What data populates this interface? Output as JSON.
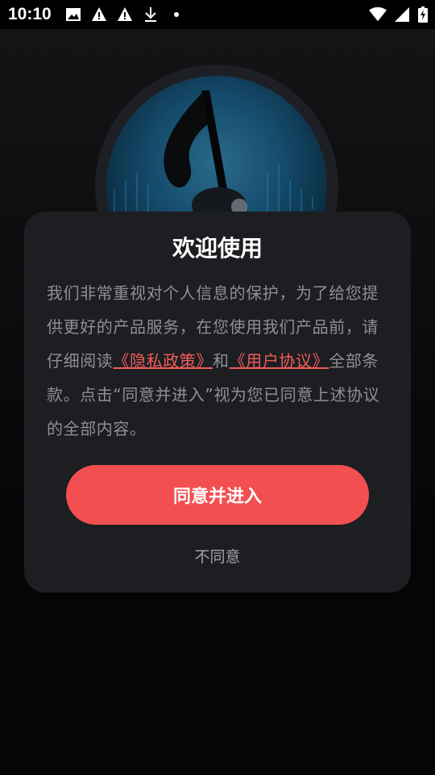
{
  "status_bar": {
    "time": "10:10",
    "left_icons": [
      "image-icon",
      "warning-icon",
      "warning-icon",
      "download-icon",
      "dot-icon"
    ],
    "right_icons": [
      "wifi-icon",
      "signal-icon",
      "battery-charging-icon"
    ]
  },
  "dialog": {
    "title": "欢迎使用",
    "body_prefix": "我们非常重视对个人信息的保护，为了给您提供更好的产品服务，在您使用我们产品前，请仔细阅读",
    "privacy_link": "《隐私政策》",
    "connector": "和",
    "user_agreement_link": "《用户协议》",
    "body_suffix": "全部条款。点击“同意并进入”视为您已同意上述协议的全部内容。",
    "agree_label": "同意并进入",
    "disagree_label": "不同意"
  },
  "colors": {
    "accent": "#f34f51",
    "link": "#f25a5a",
    "dialog_bg": "#1d1e22"
  }
}
